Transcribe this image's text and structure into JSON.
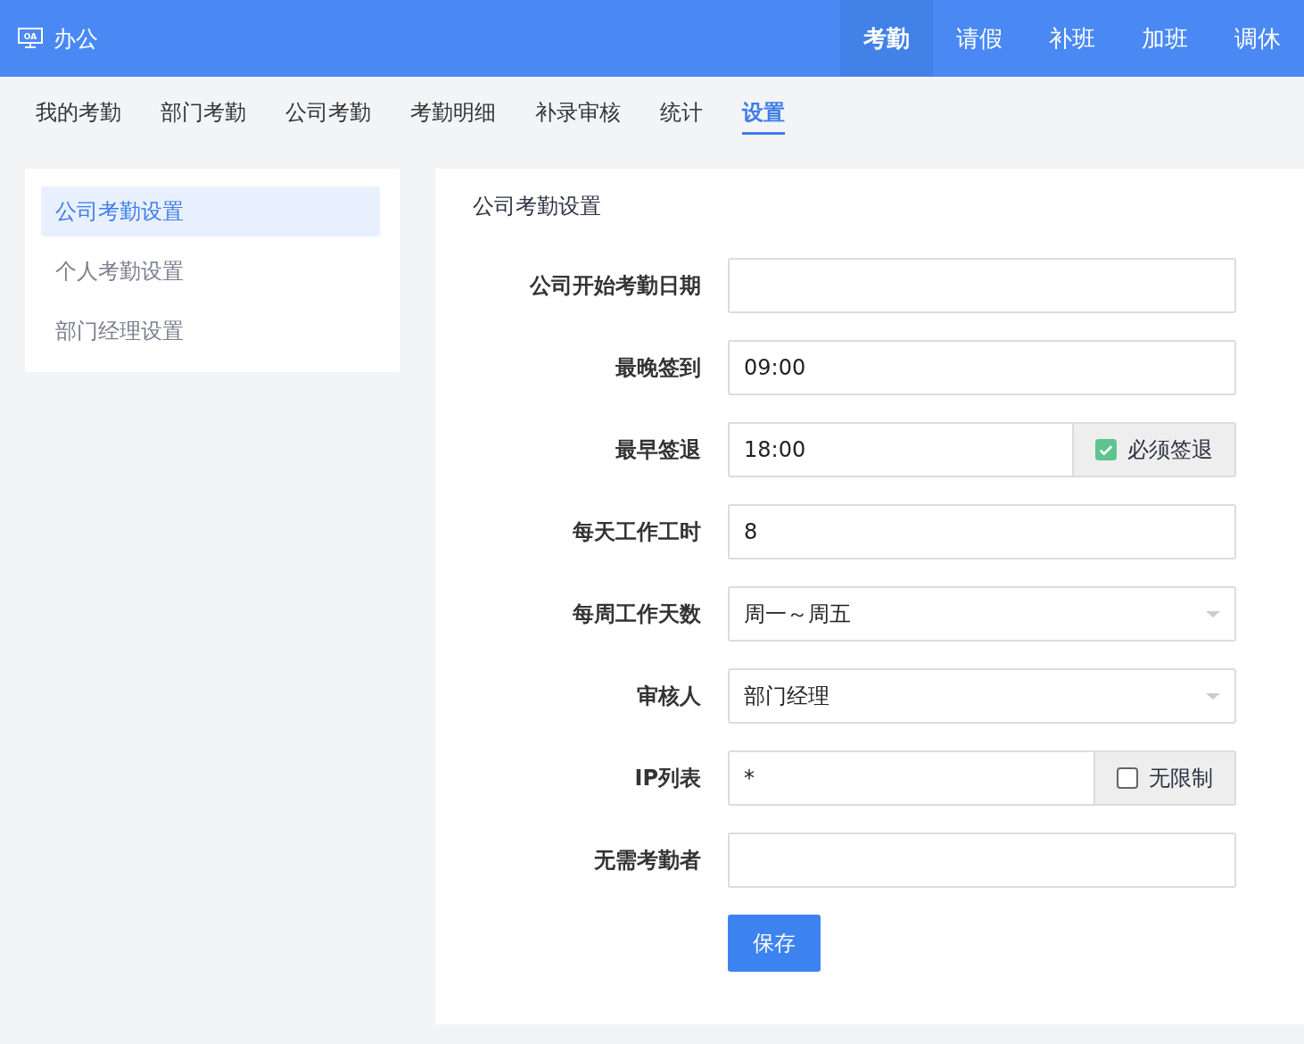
{
  "header": {
    "logo_text": "OA",
    "title": "办公",
    "nav": [
      {
        "label": "考勤",
        "selected": true
      },
      {
        "label": "请假",
        "selected": false
      },
      {
        "label": "补班",
        "selected": false
      },
      {
        "label": "加班",
        "selected": false
      },
      {
        "label": "调休",
        "selected": false
      }
    ]
  },
  "tabs": [
    {
      "label": "我的考勤",
      "selected": false
    },
    {
      "label": "部门考勤",
      "selected": false
    },
    {
      "label": "公司考勤",
      "selected": false
    },
    {
      "label": "考勤明细",
      "selected": false
    },
    {
      "label": "补录审核",
      "selected": false
    },
    {
      "label": "统计",
      "selected": false
    },
    {
      "label": "设置",
      "selected": true
    }
  ],
  "sidebar": {
    "items": [
      {
        "label": "公司考勤设置",
        "selected": true
      },
      {
        "label": "个人考勤设置",
        "selected": false
      },
      {
        "label": "部门经理设置",
        "selected": false
      }
    ]
  },
  "form": {
    "title": "公司考勤设置",
    "fields": [
      {
        "kind": "text",
        "label": "公司开始考勤日期"
      },
      {
        "kind": "text",
        "label": "最晚签到",
        "value": "09:00"
      },
      {
        "kind": "addon",
        "label": "最早签退",
        "value": "18:00",
        "option": {
          "label": "必须签退",
          "checked": true
        }
      },
      {
        "kind": "text",
        "label": "每天工作工时",
        "value": "8"
      },
      {
        "kind": "select",
        "label": "每周工作天数",
        "value": "周一～周五"
      },
      {
        "kind": "select",
        "label": "审核人",
        "value": "部门经理"
      },
      {
        "kind": "addon",
        "label": "IP列表",
        "value": "*",
        "option": {
          "label": "无限制",
          "checked": false
        }
      },
      {
        "kind": "text",
        "label": "无需考勤者"
      }
    ],
    "submit": "保存"
  }
}
